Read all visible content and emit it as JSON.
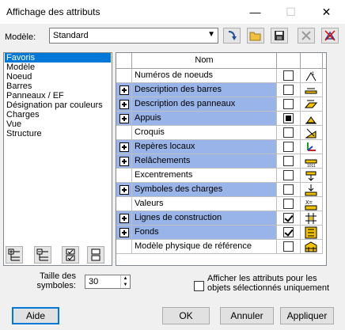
{
  "window": {
    "title": "Affichage des attributs",
    "minimize": "—",
    "maximize": "☐",
    "close": "✕"
  },
  "model": {
    "label": "Modèle:",
    "value": "Standard"
  },
  "toolbar": [
    {
      "name": "apply-icon"
    },
    {
      "name": "open-folder-icon"
    },
    {
      "name": "save-icon"
    },
    {
      "name": "delete-icon"
    },
    {
      "name": "no-attributes-icon"
    }
  ],
  "categories": {
    "items": [
      "Favoris",
      "Modèle",
      "Noeud",
      "Barres",
      "Panneaux / EF",
      "Désignation par couleurs",
      "Charges",
      "Vue",
      "Structure"
    ],
    "selected": "Favoris"
  },
  "grid": {
    "header": "Nom",
    "rows": [
      {
        "label": "Numéros de noeuds",
        "expandable": false,
        "highlighted": false,
        "state": "unchecked",
        "icon": "node-numbers-icon"
      },
      {
        "label": "Description des barres",
        "expandable": true,
        "highlighted": true,
        "state": "unchecked",
        "icon": "bar-description-icon"
      },
      {
        "label": "Description des panneaux",
        "expandable": true,
        "highlighted": true,
        "state": "unchecked",
        "icon": "panel-description-icon"
      },
      {
        "label": "Appuis",
        "expandable": true,
        "highlighted": true,
        "state": "partial",
        "icon": "supports-icon"
      },
      {
        "label": "Croquis",
        "expandable": false,
        "highlighted": false,
        "state": "unchecked",
        "icon": "sketch-icon"
      },
      {
        "label": "Repères locaux",
        "expandable": true,
        "highlighted": true,
        "state": "unchecked",
        "icon": "local-axes-icon"
      },
      {
        "label": "Relâchements",
        "expandable": true,
        "highlighted": true,
        "state": "unchecked",
        "icon": "releases-icon"
      },
      {
        "label": "Excentrements",
        "expandable": false,
        "highlighted": false,
        "state": "unchecked",
        "icon": "offsets-icon"
      },
      {
        "label": "Symboles des charges",
        "expandable": true,
        "highlighted": true,
        "state": "unchecked",
        "icon": "load-symbols-icon"
      },
      {
        "label": "Valeurs",
        "expandable": false,
        "highlighted": false,
        "state": "unchecked",
        "icon": "values-icon"
      },
      {
        "label": "Lignes de construction",
        "expandable": true,
        "highlighted": true,
        "state": "checked",
        "icon": "construction-lines-icon"
      },
      {
        "label": "Fonds",
        "expandable": true,
        "highlighted": true,
        "state": "checked",
        "icon": "backgrounds-icon"
      },
      {
        "label": "Modèle physique de référence",
        "expandable": false,
        "highlighted": false,
        "state": "unchecked",
        "icon": "physical-model-icon"
      }
    ]
  },
  "symbol_size": {
    "label": "Taille des symboles:",
    "value": "30"
  },
  "selected_only": {
    "label": "Afficher les attributs pour les objets sélectionnés uniquement",
    "checked": false
  },
  "buttons": {
    "help": "Aide",
    "ok": "OK",
    "cancel": "Annuler",
    "apply": "Appliquer"
  }
}
